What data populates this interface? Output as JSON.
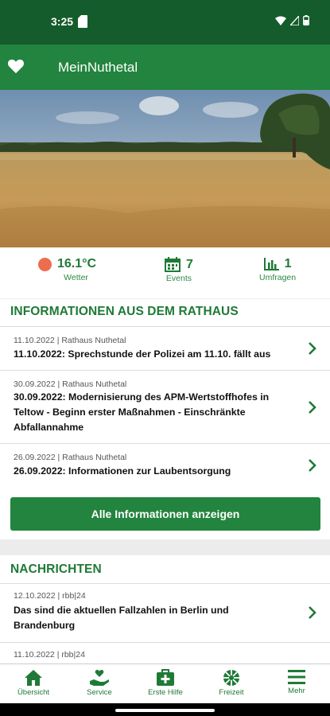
{
  "status": {
    "time": "3:25"
  },
  "appbar": {
    "title": "MeinNuthetal"
  },
  "stats": {
    "weather": {
      "value": "16.1°C",
      "label": "Wetter"
    },
    "events": {
      "value": "7",
      "label": "Events"
    },
    "polls": {
      "value": "1",
      "label": "Umfragen"
    }
  },
  "info": {
    "title": "INFORMATIONEN AUS DEM RATHAUS",
    "items": [
      {
        "meta": "11.10.2022 | Rathaus Nuthetal",
        "headline": "11.10.2022: Sprechstunde der Polizei am 11.10. fällt aus"
      },
      {
        "meta": "30.09.2022 | Rathaus Nuthetal",
        "headline": "30.09.2022: Modernisierung des APM-Wertstoffhofes in Teltow - Beginn erster Maßnahmen - Einschränkte Abfallannahme"
      },
      {
        "meta": "26.09.2022 | Rathaus Nuthetal",
        "headline": "26.09.2022: Informationen zur Laubentsorgung"
      }
    ],
    "button": "Alle Informationen anzeigen"
  },
  "news": {
    "title": "NACHRICHTEN",
    "items": [
      {
        "meta": "12.10.2022 | rbb|24",
        "headline": "Das sind die aktuellen Fallzahlen in Berlin und Brandenburg"
      },
      {
        "meta": "11.10.2022 | rbb|24",
        "headline": ""
      }
    ]
  },
  "nav": [
    {
      "label": "Übersicht",
      "icon": "home-icon"
    },
    {
      "label": "Service",
      "icon": "hand-heart-icon"
    },
    {
      "label": "Erste Hilfe",
      "icon": "first-aid-icon"
    },
    {
      "label": "Freizeit",
      "icon": "ball-icon"
    },
    {
      "label": "Mehr",
      "icon": "menu-icon"
    }
  ],
  "colors": {
    "primary": "#22843e",
    "status_bar": "#155c2c",
    "accent_text": "#1f7a36",
    "weather_dot": "#ec6e4e"
  }
}
